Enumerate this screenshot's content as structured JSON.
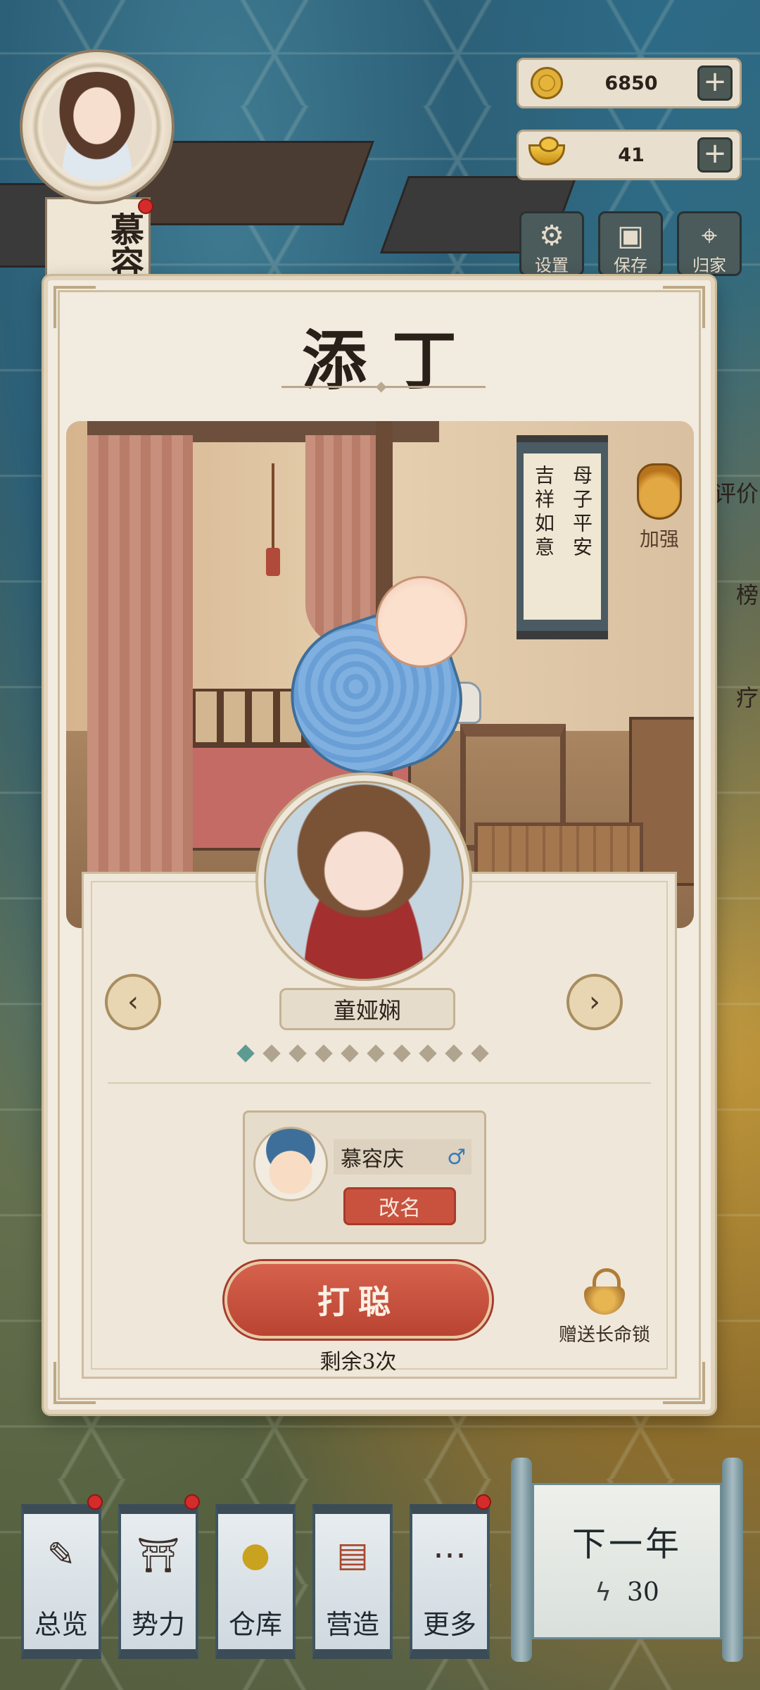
{
  "player": {
    "name": "慕容"
  },
  "resources": {
    "coins": "6850",
    "ingots": "41",
    "add_label": "+"
  },
  "tools": [
    {
      "label": "设置",
      "icon": "gear-icon"
    },
    {
      "label": "保存",
      "icon": "save-icon"
    },
    {
      "label": "归家",
      "icon": "location-icon"
    }
  ],
  "side_labels": [
    "评价",
    "榜",
    "疗"
  ],
  "dialog": {
    "title": "添丁",
    "scroll_text": [
      "母子平安",
      "吉祥如意"
    ],
    "boost_label": "加强",
    "mother_name": "童娅娴",
    "page_dots": 10,
    "active_dot": 0,
    "prev_arrow": "‹",
    "next_arrow": "›",
    "child": {
      "name": "慕容庆",
      "gender_symbol": "♂",
      "rename_label": "改名"
    },
    "main_button": "打聪",
    "remaining_text": "剩余3次",
    "gift_label": "赠送长命锁"
  },
  "bottom_nav": [
    {
      "label": "总览",
      "icon": "brush-scroll-icon",
      "badge": true
    },
    {
      "label": "势力",
      "icon": "pavilion-icon",
      "badge": true
    },
    {
      "label": "仓库",
      "icon": "sack-icon",
      "badge": false
    },
    {
      "label": "营造",
      "icon": "trowel-bricks-icon",
      "badge": false
    },
    {
      "label": "更多",
      "icon": "more-dots-icon",
      "badge": true
    }
  ],
  "next_year": {
    "label": "下一年",
    "energy": "30"
  },
  "colors": {
    "accent_red": "#c9523f",
    "gender_blue": "#3b78b8",
    "active_dot": "#5d9a92",
    "badge_red": "#d42b2b"
  }
}
